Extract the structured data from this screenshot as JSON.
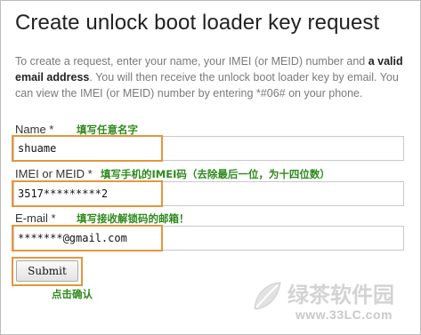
{
  "page": {
    "title": "Create unlock boot loader key request",
    "desc_part1": "To create a request, enter your name, your IMEI (or MEID) number and ",
    "desc_bold": "a valid email address",
    "desc_part2": ". You will then receive the unlock boot loader key by email. You can view the IMEI (or MEID) number by entering *#06# on your phone."
  },
  "form": {
    "name_label": "Name *",
    "name_value": "shuame",
    "name_annotation": "填写任意名字",
    "imei_label": "IMEI or MEID *",
    "imei_value": "3517*********2",
    "imei_annotation": "填写手机的IMEI码（去除最后一位，为十四位数）",
    "email_label": "E-mail *",
    "email_value": "*******@gmail.com",
    "email_annotation": "填写接收解锁码的邮箱！",
    "submit_label": "Submit",
    "submit_annotation": "点击确认"
  },
  "watermark": {
    "brand": "绿茶软件园",
    "url": "www.33LC.com"
  },
  "colors": {
    "highlight": "#e6953d",
    "annotation": "#2d8a1b"
  }
}
